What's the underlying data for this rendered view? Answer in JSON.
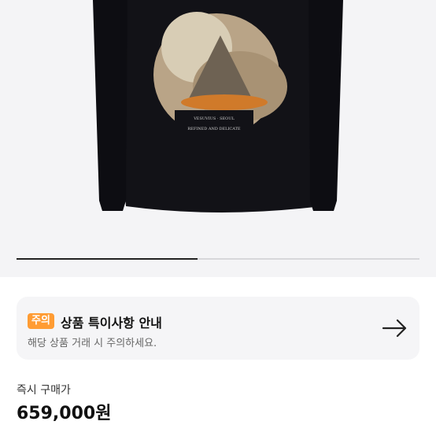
{
  "notice": {
    "badge": "주의",
    "title": "상품 특이사항 안내",
    "subtitle": "해당 상품 거래 시 주의하세요."
  },
  "purchase": {
    "label": "즉시 구매가",
    "price": "659,000원"
  },
  "gallery": {
    "progress": 0.45
  },
  "colors": {
    "badge": "#ff9c33",
    "background": "#f4f4f6"
  }
}
